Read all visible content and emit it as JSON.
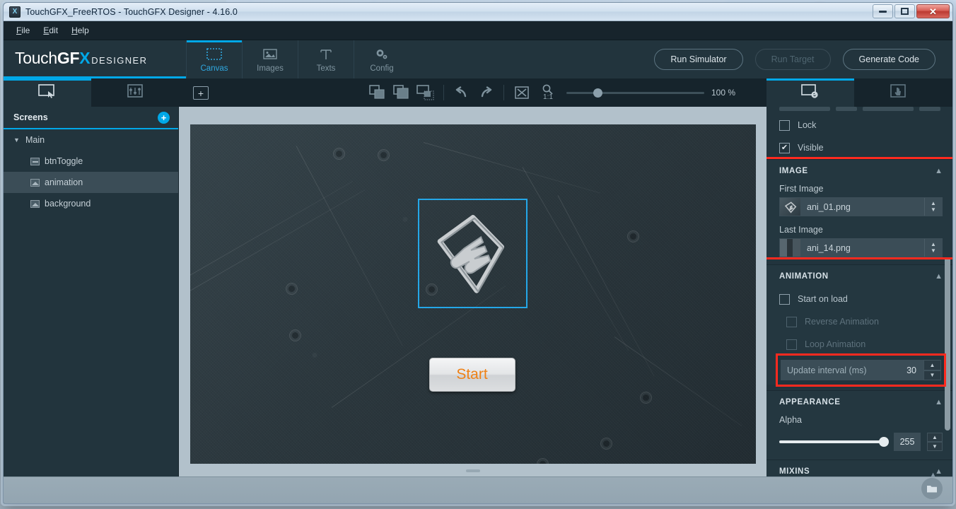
{
  "window": {
    "title": "TouchGFX_FreeRTOS - TouchGFX Designer - 4.16.0",
    "app_icon": "X",
    "minimize_label": "–",
    "maximize_label": "□",
    "close_label": "✕"
  },
  "menu": {
    "items": [
      {
        "label": "File",
        "mnemonic": "F"
      },
      {
        "label": "Edit",
        "mnemonic": "E"
      },
      {
        "label": "Help",
        "mnemonic": "H"
      }
    ]
  },
  "brand": {
    "touch": "Touch",
    "gf": "GF",
    "x": "X",
    "designer": "DESIGNER"
  },
  "header": {
    "tabs": [
      {
        "label": "Canvas",
        "icon": "canvas-dotted-rect-icon",
        "active": true
      },
      {
        "label": "Images",
        "icon": "image-icon",
        "active": false
      },
      {
        "label": "Texts",
        "icon": "text-t-icon",
        "active": false
      },
      {
        "label": "Config",
        "icon": "gear-icon",
        "active": false
      }
    ],
    "actions": [
      {
        "label": "Run Simulator",
        "enabled": true
      },
      {
        "label": "Run Target",
        "enabled": false
      },
      {
        "label": "Generate Code",
        "enabled": true
      }
    ]
  },
  "toolbar": {
    "left_tabs": [
      {
        "icon": "screen-select-icon",
        "active": true
      },
      {
        "icon": "sliders-icon",
        "active": false
      }
    ],
    "add_widget_label": "+",
    "tools": [
      {
        "icon": "bring-to-front-icon"
      },
      {
        "icon": "send-to-back-icon"
      },
      {
        "icon": "align-icon"
      },
      {
        "icon": "undo-icon"
      },
      {
        "icon": "redo-icon"
      },
      {
        "icon": "fit-to-screen-icon"
      },
      {
        "icon": "zoom-one-to-one-icon"
      }
    ],
    "zoom_ratio_label": "1:1",
    "zoom_value": "100 %",
    "zoom_percent": 100
  },
  "screens_panel": {
    "title": "Screens",
    "add_label": "+",
    "tree": [
      {
        "label": "Main",
        "type": "group",
        "expanded": true,
        "chevron": "⌄"
      },
      {
        "label": "btnToggle",
        "type": "button",
        "icon": "button-widget-icon",
        "selected": false
      },
      {
        "label": "animation",
        "type": "image",
        "icon": "image-widget-icon",
        "selected": true
      },
      {
        "label": "background",
        "type": "image",
        "icon": "image-widget-icon",
        "selected": false
      }
    ]
  },
  "canvas": {
    "device_width": 800,
    "device_height": 480,
    "selected_widget": "animation",
    "widgets": [
      {
        "name": "animation",
        "kind": "animated-image",
        "selected": true
      },
      {
        "name": "btnToggle",
        "kind": "button",
        "label": "Start",
        "text_color": "#ef8115"
      }
    ]
  },
  "properties": {
    "tabs": [
      {
        "icon": "widget-properties-icon",
        "active": true
      },
      {
        "icon": "interactions-hand-icon",
        "active": false
      }
    ],
    "checkboxes": [
      {
        "label": "Lock",
        "checked": false,
        "enabled": true
      },
      {
        "label": "Visible",
        "checked": true,
        "enabled": true,
        "check_glyph": "✔"
      }
    ],
    "image_section": {
      "title": "IMAGE",
      "caret": "⌃",
      "highlighted": true,
      "first_image_label": "First Image",
      "first_image_value": "ani_01.png",
      "last_image_label": "Last Image",
      "last_image_value": "ani_14.png",
      "spinner_up": "▲",
      "spinner_down": "▼"
    },
    "animation_section": {
      "title": "ANIMATION",
      "caret": "⌃",
      "checkboxes": [
        {
          "label": "Start on load",
          "checked": false,
          "enabled": true
        },
        {
          "label": "Reverse Animation",
          "checked": false,
          "enabled": false
        },
        {
          "label": "Loop Animation",
          "checked": false,
          "enabled": false
        }
      ],
      "update_interval_label": "Update interval (ms)",
      "update_interval_value": "30",
      "update_interval_highlighted": true
    },
    "appearance_section": {
      "title": "APPEARANCE",
      "caret": "⌃",
      "alpha_label": "Alpha",
      "alpha_value": "255",
      "alpha_percent": 100
    },
    "mixins_section": {
      "title": "MIXINS",
      "caret": "⌃"
    }
  },
  "colors": {
    "accent_blue": "#00a8e8",
    "panel_bg": "#22343d",
    "toolbar_bg": "#16242c",
    "highlight_red": "#ff2a1f",
    "selection_blue": "#24a7e8",
    "button_orange": "#ef8115",
    "canvas_surround": "#b2c1cb"
  },
  "statusbar": {
    "text": "",
    "tray_icon": "folder-icon",
    "caret": "⌃"
  }
}
